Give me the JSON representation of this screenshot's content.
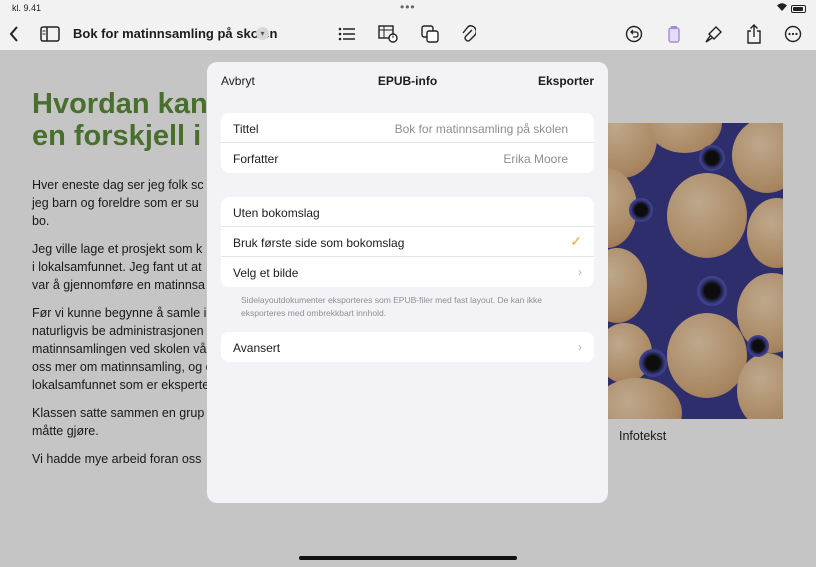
{
  "status": {
    "time": "kl. 9.41",
    "dots": "•••"
  },
  "toolbar": {
    "doc_title": "Bok for matinnsamling på skolen",
    "icons": [
      "chevron-left-icon",
      "sidebar-icon",
      "list-icon",
      "table-chart-icon",
      "shapes-icon",
      "paperclip-icon",
      "undo-icon",
      "color-icon",
      "paintbrush-icon",
      "share-icon",
      "more-icon"
    ]
  },
  "document": {
    "heading": "Hvordan kan\nen forskjell i",
    "paragraphs": [
      "Hver eneste dag ser jeg folk sc\njeg barn og foreldre som er su\nbo.",
      "Jeg ville lage et prosjekt som k\ni lokalsamfunnet. Jeg fant ut at\nvar å gjennomføre en matinnsa",
      "Før vi kunne begynne å samle ir\nnaturligvis be administrasjonen\nmatinnsamlingen ved skolen vå\noss mer om matinnsamling, og c\nlokalsamfunnet som er eksperte",
      "Klassen satte sammen en grup\nmåtte gjøre.",
      "Vi hadde mye arbeid foran oss"
    ],
    "caption": "Infotekst"
  },
  "modal": {
    "cancel": "Avbryt",
    "title": "EPUB-info",
    "export": "Eksporter",
    "fields": [
      {
        "label": "Tittel",
        "placeholder": "Bok for matinnsamling på skolen"
      },
      {
        "label": "Forfatter",
        "placeholder": "Erika Moore"
      }
    ],
    "cover_options": [
      {
        "label": "Uten bokomslag",
        "selected": false
      },
      {
        "label": "Bruk første side som bokomslag",
        "selected": true
      },
      {
        "label": "Velg et bilde",
        "selected": false
      }
    ],
    "footnote": "Sidelayoutdokumenter eksporteres som EPUB-filer med fast layout. De kan ikke eksporteres med ombrekkbart innhold.",
    "advanced": "Avansert",
    "check_mark": "✓",
    "chevron": "›"
  },
  "colors": {
    "accent": "#f5a623",
    "heading_green": "#5d8f3a"
  }
}
